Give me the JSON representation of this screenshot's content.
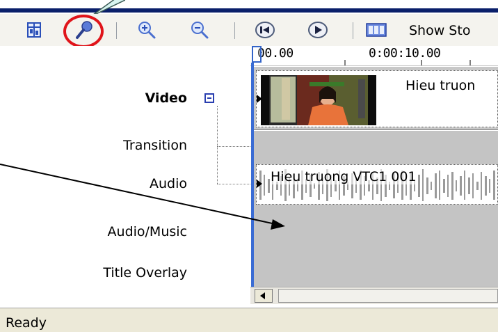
{
  "toolbar": {
    "show_storyboard_label": "Show Sto",
    "buttons": [
      "set-audio-levels",
      "narrate-timeline",
      "zoom-in",
      "zoom-out",
      "rewind",
      "play",
      "show-storyboard"
    ]
  },
  "ruler": {
    "tick_0": "00.00",
    "tick_1": "0:00:10.00"
  },
  "tracks": {
    "video": "Video",
    "transition": "Transition",
    "audio": "Audio",
    "audio_music": "Audio/Music",
    "title_overlay": "Title Overlay"
  },
  "clips": {
    "video_clip": "Hieu truon",
    "audio_clip": "Hieu truong VTC1 001"
  },
  "status": {
    "text": "Ready"
  },
  "colors": {
    "highlight_circle": "#e0141a",
    "playhead": "#3a6cd4",
    "title_bar": "#0a1f6a"
  }
}
